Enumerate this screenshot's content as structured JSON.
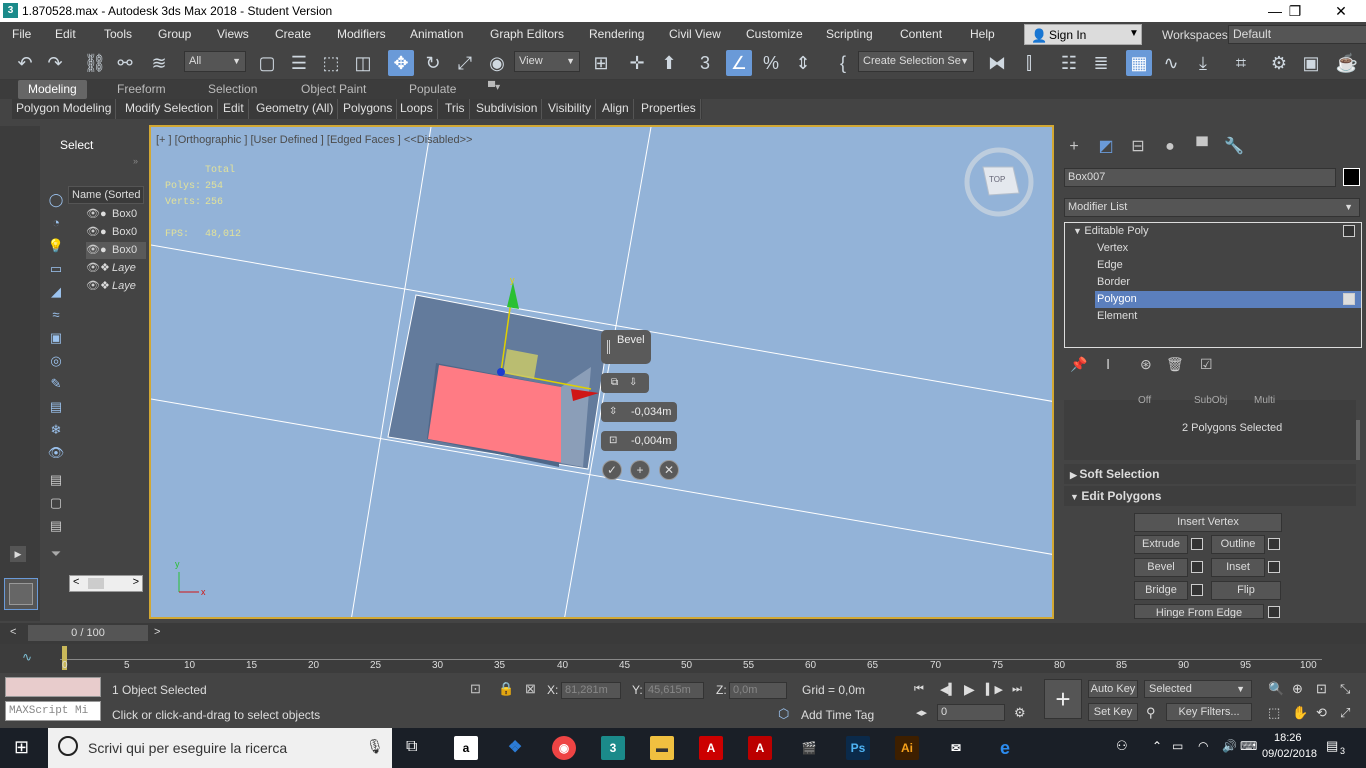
{
  "window": {
    "title": "1.870528.max - Autodesk 3ds Max 2018 - Student Version",
    "minimize": "—",
    "restore": "❐",
    "close": "✕"
  },
  "menu": [
    "File",
    "Edit",
    "Tools",
    "Group",
    "Views",
    "Create",
    "Modifiers",
    "Animation",
    "Graph Editors",
    "Rendering",
    "Civil View",
    "Customize",
    "Scripting",
    "Content",
    "Help"
  ],
  "signin": "Sign In",
  "workspaces": {
    "label": "Workspaces:",
    "value": "Default"
  },
  "toolbar": {
    "filter": "All",
    "refcoord": "View",
    "selection_set": "Create Selection Se"
  },
  "ribbon": {
    "tabs": [
      "Modeling",
      "Freeform",
      "Selection",
      "Object Paint",
      "Populate"
    ],
    "subtabs": [
      "Polygon Modeling",
      "Modify Selection",
      "Edit",
      "Geometry (All)",
      "Polygons",
      "Loops",
      "Tris",
      "Subdivision",
      "Visibility",
      "Align",
      "Properties"
    ]
  },
  "scene_explorer": {
    "header": "Select",
    "name_column": "Name (Sorted A",
    "items": [
      {
        "name": "Box0",
        "type": "object"
      },
      {
        "name": "Box0",
        "type": "object"
      },
      {
        "name": "Box0",
        "type": "object"
      },
      {
        "name": "Laye",
        "type": "layer"
      },
      {
        "name": "Laye",
        "type": "layer"
      }
    ]
  },
  "viewport": {
    "label": "[+ ] [Orthographic ] [User Defined ] [Edged Faces ]  <<Disabled>>",
    "stats": {
      "total_label": "Total",
      "polys_label": "Polys:",
      "polys": "254",
      "verts_label": "Verts:",
      "verts": "256",
      "fps_label": "FPS:",
      "fps": "48,012"
    },
    "viewcube_label": "TOP",
    "caddy": {
      "title": "Bevel",
      "height": "-0,034m",
      "outline": "-0,004m"
    }
  },
  "command_panel": {
    "object_name": "Box007",
    "modifier_list": "Modifier List",
    "stack": [
      "Editable Poly",
      "Vertex",
      "Edge",
      "Border",
      "Polygon",
      "Element"
    ],
    "selected_stack": "Polygon",
    "partial_labels": [
      "Off",
      "SubObj",
      "Multi"
    ],
    "selection_info": "2 Polygons Selected",
    "soft_selection": "Soft Selection",
    "edit_polygons": "Edit Polygons",
    "buttons": {
      "insert_vertex": "Insert Vertex",
      "extrude": "Extrude",
      "outline": "Outline",
      "bevel": "Bevel",
      "inset": "Inset",
      "bridge": "Bridge",
      "flip": "Flip",
      "hinge": "Hinge From Edge"
    }
  },
  "timeslider": {
    "frame": "0 / 100"
  },
  "trackbar": {
    "ticks": [
      "0",
      "5",
      "10",
      "15",
      "20",
      "25",
      "30",
      "35",
      "40",
      "45",
      "50",
      "55",
      "60",
      "65",
      "70",
      "75",
      "80",
      "85",
      "90",
      "95",
      "100"
    ]
  },
  "status": {
    "maxscript": "MAXScript Mi",
    "objects_selected": "1 Object Selected",
    "prompt": "Click or click-and-drag to select objects",
    "x_label": "X:",
    "x": "81,281m",
    "y_label": "Y:",
    "y": "45,615m",
    "z_label": "Z:",
    "z": "0,0m",
    "grid": "Grid = 0,0m",
    "add_time_tag": "Add Time Tag",
    "auto_key": "Auto Key",
    "set_key": "Set Key",
    "key_mode": "Selected",
    "key_filters": "Key Filters...",
    "current_frame": "0"
  },
  "taskbar": {
    "search": "Scrivi qui per eseguire la ricerca",
    "time": "18:26",
    "date": "09/02/2018",
    "notifications": "3"
  },
  "colors": {
    "viewport_bg": "#93b3d8",
    "viewport_border": "#d2a834",
    "selected_polygon": "#ff7b84",
    "highlight": "#5b7fbd",
    "stats_text": "#e2e29a"
  }
}
